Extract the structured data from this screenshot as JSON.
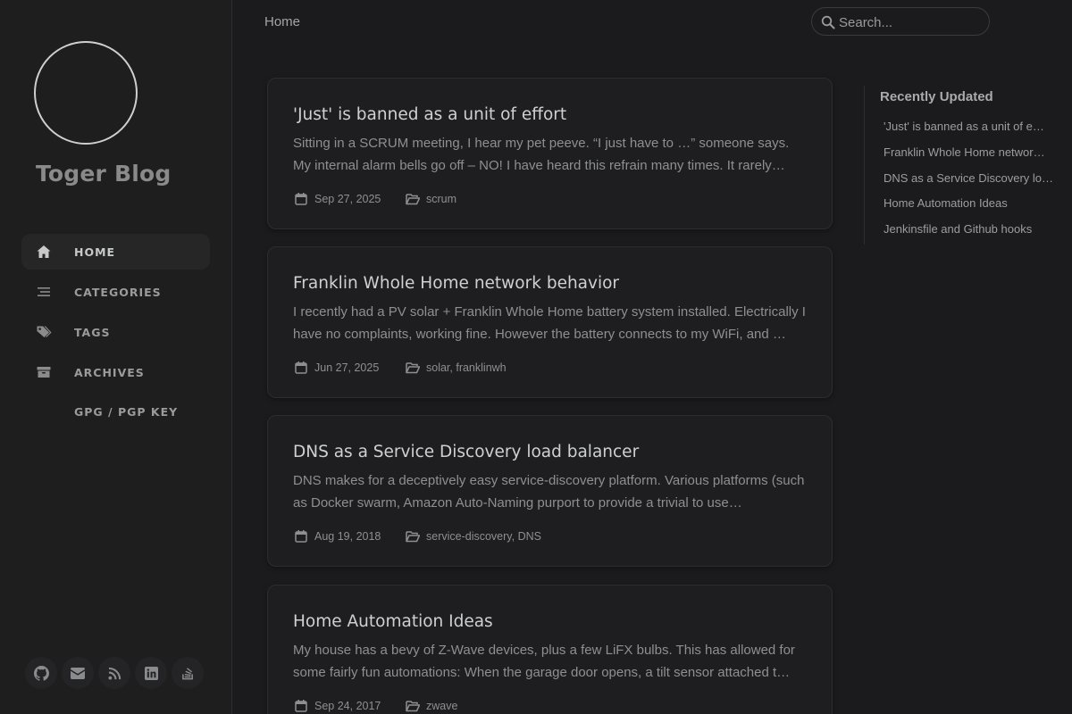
{
  "site": {
    "title": "Toger Blog"
  },
  "nav": {
    "items": [
      {
        "label": "HOME",
        "icon": "home-icon",
        "active": true
      },
      {
        "label": "CATEGORIES",
        "icon": "stream-icon"
      },
      {
        "label": "TAGS",
        "icon": "tags-icon"
      },
      {
        "label": "ARCHIVES",
        "icon": "archive-icon"
      },
      {
        "label": "GPG / PGP KEY",
        "icon": ""
      }
    ]
  },
  "social": [
    "github-icon",
    "email-icon",
    "rss-icon",
    "linkedin-icon",
    "stack-overflow-icon"
  ],
  "topbar": {
    "breadcrumb": "Home",
    "search_placeholder": "Search..."
  },
  "posts": [
    {
      "title": "'Just' is banned as a unit of effort",
      "excerpt": "Sitting in a SCRUM meeting, I hear my pet peeve. “I just have to …” someone says. My internal alarm bells go off – NO! I have heard this refrain many times. It rarely…",
      "date": "Sep 27, 2025",
      "categories": "scrum"
    },
    {
      "title": "Franklin Whole Home network behavior",
      "excerpt": "I recently had a PV solar + Franklin Whole Home battery system installed. Electrically I have no complaints, working fine. However the battery connects to my WiFi, and …",
      "date": "Jun 27, 2025",
      "categories": "solar, franklinwh"
    },
    {
      "title": "DNS as a Service Discovery load balancer",
      "excerpt": "DNS makes for a deceptively easy service-discovery platform. Various platforms (such as Docker swarm, Amazon Auto-Naming purport to provide a trivial to use…",
      "date": "Aug 19, 2018",
      "categories": "service-discovery, DNS"
    },
    {
      "title": "Home Automation Ideas",
      "excerpt": "My house has a bevy of Z-Wave devices, plus a few LiFX bulbs. This has allowed for some fairly fun automations: When the garage door opens, a tilt sensor attached t…",
      "date": "Sep 24, 2017",
      "categories": "zwave"
    }
  ],
  "panel": {
    "title": "Recently Updated",
    "items": [
      "'Just' is banned as a unit of e…",
      "Franklin Whole Home networ…",
      "DNS as a Service Discovery lo…",
      "Home Automation Ideas",
      "Jenkinsfile and Github hooks"
    ]
  },
  "colors": {
    "background": "#1b1b1e",
    "sidebar": "#1e1e1e",
    "card": "#1e1e20",
    "text": "#afb0b1"
  }
}
